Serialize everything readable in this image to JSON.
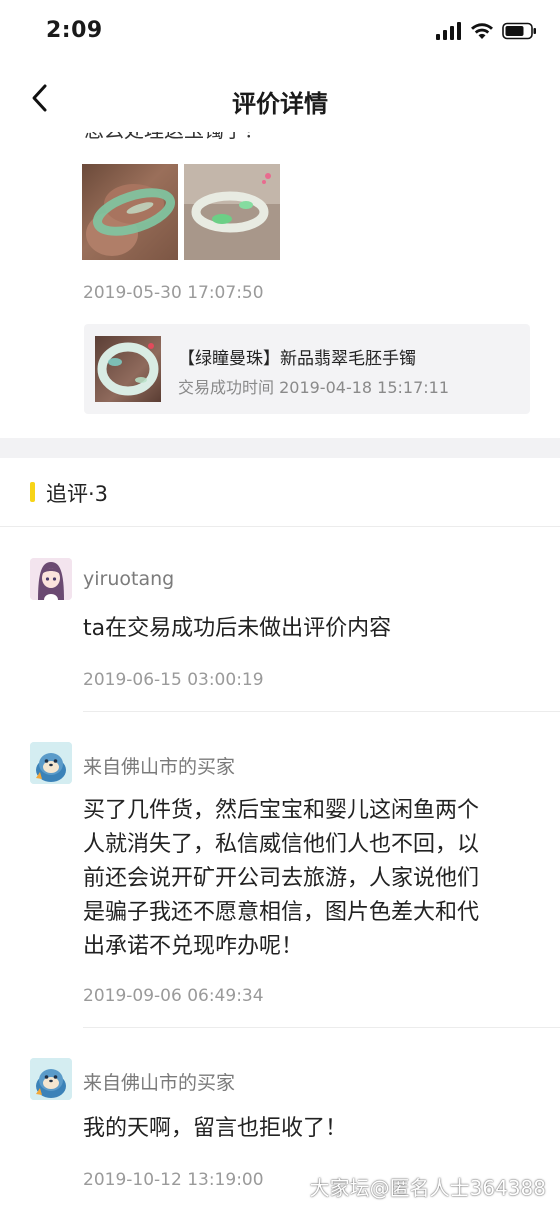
{
  "status_bar": {
    "time": "2:09",
    "icons": [
      "signal-icon",
      "wifi-icon",
      "battery-icon"
    ]
  },
  "nav": {
    "title": "评价详情",
    "back_icon": "chevron-left-icon"
  },
  "review": {
    "cut_text": "怎么处理这玉镯子？",
    "photos": [
      "jade-bangle-on-hand",
      "jade-bangle-on-table"
    ],
    "date": "2019-05-30 17:07:50",
    "product": {
      "name": "【绿瞳曼珠】新品翡翠毛胚手镯",
      "trade_time": "交易成功时间 2019-04-18 15:17:11"
    }
  },
  "followups": {
    "title": "追评·3",
    "items": [
      {
        "user": "yiruotang",
        "avatar": "anime-girl-avatar",
        "text": "ta在交易成功后未做出评价内容",
        "date": "2019-06-15 03:00:19"
      },
      {
        "user": "来自佛山市的买家",
        "avatar": "seal-avatar",
        "text_lines": [
          "买了几件货，然后宝宝和婴儿这闲鱼两个",
          "人就消失了，私信威信他们人也不回，以",
          "前还会说开矿开公司去旅游，人家说他们",
          "是骗子我还不愿意相信，图片色差大和代",
          "出承诺不兑现咋办呢！"
        ],
        "date": "2019-09-06 06:49:34"
      },
      {
        "user": "来自佛山市的买家",
        "avatar": "seal-avatar",
        "text": "我的天啊，留言也拒收了！",
        "date": "2019-10-12 13:19:00"
      }
    ]
  },
  "watermark": "大家坛@匿名人士364388",
  "colors": {
    "accent": "#f7d417",
    "secondary_text": "#9a9a9a",
    "section_gap": "#f2f2f4"
  }
}
